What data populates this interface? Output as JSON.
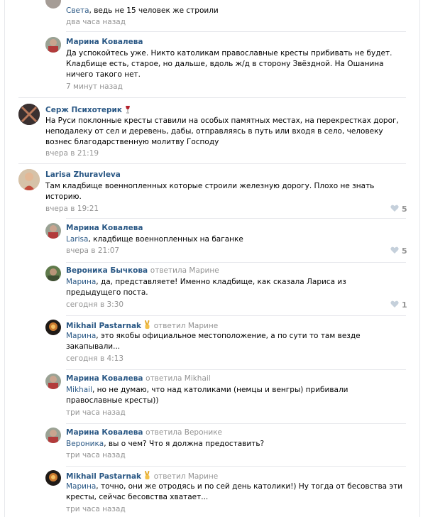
{
  "comments": [
    {
      "text_mention": "Света",
      "text": ", ведь не 15 человек же строили",
      "date": "два часа назад"
    },
    {
      "author": "Марина Ковалева",
      "text": "Да успокойтесь уже. Никто католикам православные кресты прибивать не будет. Кладбище есть, старое, но дальше, вдоль ж/д в сторону Звёздной. На Ошанина ничего такого нет.",
      "date": "7 минут назад"
    },
    {
      "author": "Серж Психотерик",
      "text": "На Руси поклонные кресты ставили на особых памятных местах, на перекрестках дорог, неподалеку от сел и деревень, дабы, отправляясь в путь или входя в село, человеку вознес благодарственную молитву Господу",
      "date": "вчера в 21:19"
    },
    {
      "author": "Larisa Zhuravleva",
      "text": "Там кладбище военнопленных которые строили железную дорогу. Плохо не знать историю.",
      "date": "вчера в 19:21",
      "likes": "5"
    },
    {
      "author": "Марина Ковалева",
      "text_mention": "Larisa",
      "text": ", кладбище военнопленных на баганке",
      "date": "вчера в 21:07",
      "likes": "5"
    },
    {
      "author": "Вероника Бычкова",
      "reply_to": "ответила Марине",
      "text_mention": "Марина",
      "text": ", да, представляете! Именно кладбище, как сказала Лариса из предыдущего поста.",
      "date": "сегодня в 3:30",
      "likes": "1"
    },
    {
      "author": "Mikhail Pastarnak",
      "reply_to": "ответил Марине",
      "text_mention": "Марина",
      "text": ", это якобы официальное местоположение, а по сути то там везде закапывали...",
      "date": "сегодня в 4:13"
    },
    {
      "author": "Марина Ковалева",
      "reply_to": "ответила Mikhail",
      "text_mention": "Mikhail",
      "text": ", но не думаю, что над католиками (немцы и венгры) прибивали православные кресты))",
      "date": "три часа назад"
    },
    {
      "author": "Марина Ковалева",
      "reply_to": "ответила Веронике",
      "text_mention": "Вероника",
      "text": ", вы о чем? Что я должна предоставить?",
      "date": "три часа назад"
    },
    {
      "author": "Mikhail Pastarnak",
      "reply_to": "ответил Марине",
      "text_mention": "Марина",
      "text": ", точно, они же отродясь и по сей день католики!) Ну тогда от бесовства эти кресты, сейчас бесовства хватает...",
      "date": "три часа назад"
    }
  ],
  "colors": {
    "author": "#2a5885",
    "muted": "#939393",
    "separator": "#e7e8ec"
  }
}
